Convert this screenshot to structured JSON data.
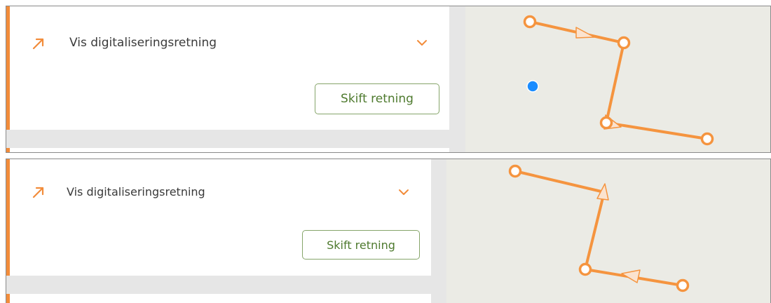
{
  "panels": [
    {
      "id": "before",
      "title": "Vis digitaliseringsretning",
      "button_label": "Skift retning",
      "direction_icon": "arrow-up-right-icon",
      "expand_icon": "chevron-down-icon"
    },
    {
      "id": "after",
      "title": "Vis digitaliseringsretning",
      "button_label": "Skift retning",
      "direction_icon": "arrow-up-right-icon",
      "expand_icon": "chevron-down-icon"
    }
  ],
  "colors": {
    "accent": "#f28c3a",
    "line": "#f5943f",
    "button_border": "#86a56a",
    "button_text": "#4e7a2e",
    "map_bg": "#ebebe5",
    "location_dot": "#1a8cff"
  }
}
